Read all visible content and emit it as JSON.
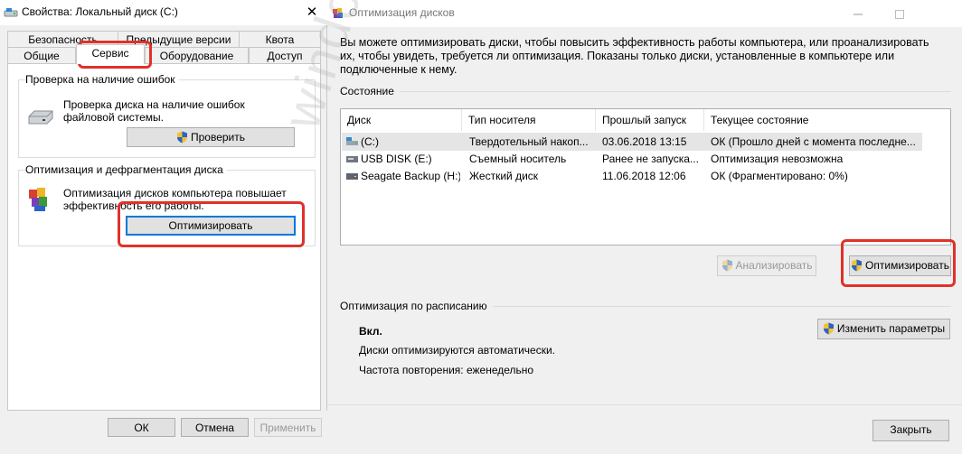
{
  "left_window": {
    "title": "Свойства: Локальный диск (C:)",
    "close_glyph": "✕",
    "tabs_row1": [
      "Безопасность",
      "Предыдущие версии",
      "Квота"
    ],
    "tabs_row2": [
      "Общие",
      "Сервис",
      "Оборудование",
      "Доступ"
    ],
    "active_tab": "Сервис",
    "error_check": {
      "group_label": "Проверка на наличие ошибок",
      "description": "Проверка диска на наличие ошибок файловой системы.",
      "button": "Проверить"
    },
    "optimize": {
      "group_label": "Оптимизация и дефрагментация диска",
      "description": "Оптимизация дисков компьютера повышает эффективность его работы.",
      "button": "Оптимизировать"
    },
    "footer": {
      "ok": "ОК",
      "cancel": "Отмена",
      "apply": "Применить"
    }
  },
  "right_window": {
    "title": "Оптимизация дисков",
    "description": "Вы можете оптимизировать диски, чтобы повысить эффективность работы  компьютера, или проанализировать их, чтобы увидеть, требуется ли оптимизация. Показаны только диски, установленные в компьютере или подключенные к нему.",
    "status_label": "Состояние",
    "columns": [
      "Диск",
      "Тип носителя",
      "Прошлый запуск",
      "Текущее состояние"
    ],
    "drives": [
      {
        "name": "(C:)",
        "type": "Твердотельный накоп...",
        "last_run": "03.06.2018 13:15",
        "status": "ОК (Прошло дней с момента последне...",
        "icon": "system-drive-icon"
      },
      {
        "name": "USB DISK (E:)",
        "type": "Съемный носитель",
        "last_run": "Ранее не запуска...",
        "status": "Оптимизация невозможна",
        "icon": "usb-drive-icon"
      },
      {
        "name": "Seagate Backup (H:)",
        "type": "Жесткий диск",
        "last_run": "11.06.2018 12:06",
        "status": "ОК (Фрагментировано: 0%)",
        "icon": "hard-drive-icon"
      }
    ],
    "analyze_button": "Анализировать",
    "optimize_button": "Оптимизировать",
    "schedule": {
      "label": "Оптимизация по расписанию",
      "state": "Вкл.",
      "auto_text": "Диски оптимизируются автоматически.",
      "frequency": "Частота повторения: еженедельно",
      "change_button": "Изменить параметры"
    },
    "close_button": "Закрыть"
  },
  "watermark": "windowsten.ru",
  "colors": {
    "highlight_red": "#e0312b",
    "focus_blue": "#0078d7",
    "window_bg": "#f0f0f0"
  }
}
